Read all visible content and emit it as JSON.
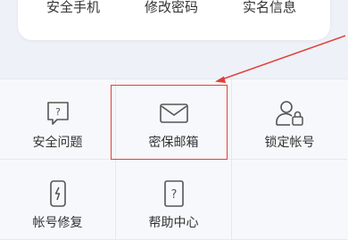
{
  "top_links": {
    "security_phone": "安全手机",
    "change_password": "修改密码",
    "real_name_info": "实名信息"
  },
  "grid_items": [
    {
      "label": "安全问题",
      "icon": "question-card-icon"
    },
    {
      "label": "密保邮箱",
      "icon": "envelope-icon"
    },
    {
      "label": "锁定帐号",
      "icon": "user-lock-icon"
    },
    {
      "label": "帐号修复",
      "icon": "phone-repair-icon"
    },
    {
      "label": "帮助中心",
      "icon": "help-question-icon"
    },
    {
      "label": "",
      "icon": ""
    }
  ],
  "annotation": {
    "highlight_color": "#e0403a"
  }
}
